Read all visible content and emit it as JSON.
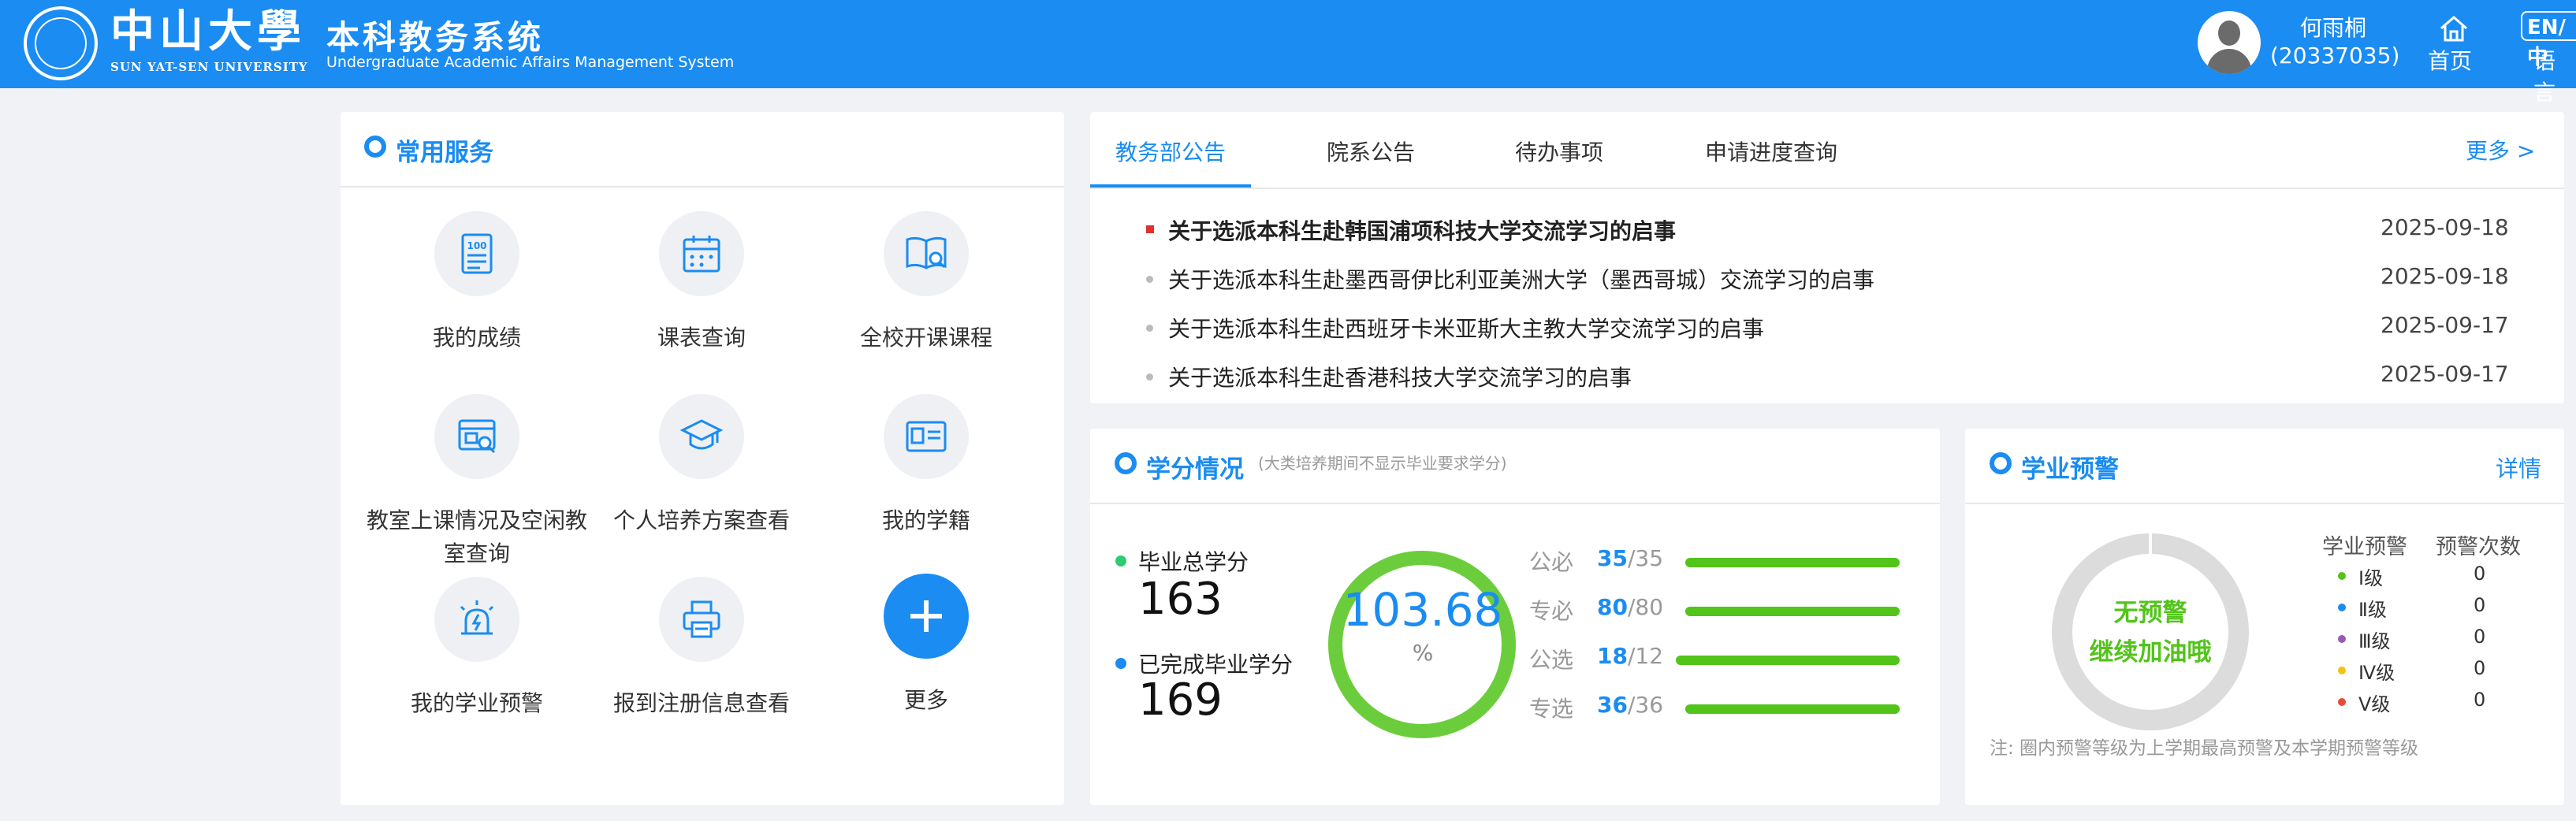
{
  "header": {
    "logo_cn": "中山大學",
    "logo_en": "SUN YAT-SEN UNIVERSITY",
    "system_cn": "本科教务系统",
    "system_en": "Undergraduate Academic Affairs Management System",
    "user_name": "何雨桐",
    "user_id": "(20337035)",
    "home_label": "首页",
    "lang_badge": "EN/中",
    "lang_label": "语言"
  },
  "services": {
    "title": "常用服务",
    "items": [
      {
        "label": "我的成绩",
        "icon": "report-icon"
      },
      {
        "label": "课表查询",
        "icon": "calendar-icon"
      },
      {
        "label": "全校开课课程",
        "icon": "book-search-icon"
      },
      {
        "label": "教室上课情况及空闲教室查询",
        "icon": "classroom-search-icon"
      },
      {
        "label": "个人培养方案查看",
        "icon": "graduation-cap-icon"
      },
      {
        "label": "我的学籍",
        "icon": "id-card-icon"
      },
      {
        "label": "我的学业预警",
        "icon": "alarm-icon"
      },
      {
        "label": "报到注册信息查看",
        "icon": "printer-icon"
      },
      {
        "label": "更多",
        "icon": "plus-icon"
      }
    ]
  },
  "notices": {
    "tabs": [
      "教务部公告",
      "院系公告",
      "待办事项",
      "申请进度查询"
    ],
    "active_tab": 0,
    "more": "更多 >",
    "items": [
      {
        "title": "关于选派本科生赴韩国浦项科技大学交流学习的启事",
        "date": "2025-09-18",
        "highlight": true
      },
      {
        "title": "关于选派本科生赴墨西哥伊比利亚美洲大学（墨西哥城）交流学习的启事",
        "date": "2025-09-18",
        "highlight": false
      },
      {
        "title": "关于选派本科生赴西班牙卡米亚斯大主教大学交流学习的启事",
        "date": "2025-09-17",
        "highlight": false
      },
      {
        "title": "关于选派本科生赴香港科技大学交流学习的启事",
        "date": "2025-09-17",
        "highlight": false
      }
    ]
  },
  "credits": {
    "title": "学分情况",
    "note": "(大类培养期间不显示毕业要求学分)",
    "total_label": "毕业总学分",
    "total_value": "163",
    "completed_label": "已完成毕业学分",
    "completed_value": "169",
    "ring_value": "103.68",
    "ring_unit": "%",
    "categories": [
      {
        "label": "公必",
        "earned": "35",
        "required": "/35"
      },
      {
        "label": "专必",
        "earned": "80",
        "required": "/80"
      },
      {
        "label": "公选",
        "earned": "18",
        "required": "/12"
      },
      {
        "label": "专选",
        "earned": "36",
        "required": "/36"
      }
    ],
    "colors": {
      "total": "#2ecc71",
      "completed": "#1a8cf2",
      "ring": "#52c41a"
    }
  },
  "warning": {
    "title": "学业预警",
    "detail": "详情",
    "donut_line1": "无预警",
    "donut_line2": "继续加油哦",
    "col_level": "学业预警",
    "col_count": "预警次数",
    "levels": [
      {
        "label": "Ⅰ级",
        "count": "0",
        "color": "#52c41a"
      },
      {
        "label": "Ⅱ级",
        "count": "0",
        "color": "#1a8cf2"
      },
      {
        "label": "Ⅲ级",
        "count": "0",
        "color": "#9b59b6"
      },
      {
        "label": "Ⅳ级",
        "count": "0",
        "color": "#f1c40f"
      },
      {
        "label": "Ⅴ级",
        "count": "0",
        "color": "#e74c3c"
      }
    ],
    "note": "注: 圈内预警等级为上学期最高预警及本学期预警等级"
  }
}
